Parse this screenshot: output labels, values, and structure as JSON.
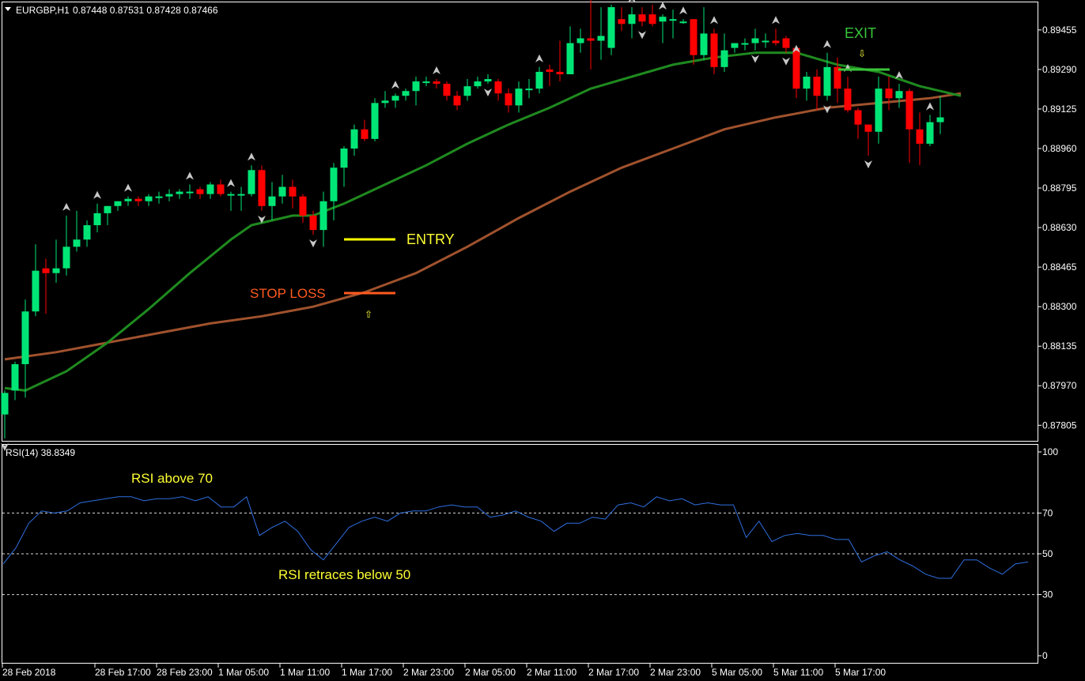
{
  "header": {
    "symbol": "EURGBP,H1",
    "ohlc": "0.87448 0.87531 0.87428 0.87466"
  },
  "rsi_panel": {
    "label": "RSI(14) 38.8349"
  },
  "colors": {
    "background": "#000000",
    "frame": "#ffffff",
    "bull_candle": "#00e676",
    "bear_candle": "#ff0000",
    "ma_fast": "#1f8a1f",
    "ma_slow": "#a0522d",
    "rsi_line": "#2f6fe0",
    "rsi_levels": "#d9d9d9",
    "signal_arrows": "#c8c8c8",
    "entry_color": "#ffff00",
    "stop_color": "#ff5a1f",
    "exit_color": "#39c639",
    "text_yellow": "#ffff33"
  },
  "annotations": {
    "entry": "ENTRY",
    "stop_loss": "STOP LOSS",
    "exit": "EXIT",
    "rsi_above": "RSI above 70",
    "rsi_retrace": "RSI retraces below 50"
  },
  "chart_data": [
    {
      "type": "candlestick",
      "title": "EURGBP,H1",
      "ylim": [
        0.8774,
        0.8957
      ],
      "y_ticks": [
        "0.89455",
        "0.89290",
        "0.89125",
        "0.88960",
        "0.88795",
        "0.88630",
        "0.88465",
        "0.88300",
        "0.88135",
        "0.87970",
        "0.87805"
      ],
      "x_ticks": [
        "28 Feb 2018",
        "28 Feb 17:00",
        "28 Feb 23:00",
        "1 Mar 05:00",
        "1 Mar 11:00",
        "1 Mar 17:00",
        "2 Mar 23:00",
        "2 Mar 05:00",
        "2 Mar 11:00",
        "2 Mar 17:00",
        "2 Mar 23:00",
        "5 Mar 05:00",
        "5 Mar 11:00",
        "5 Mar 17:00"
      ],
      "x_tick_candle": [
        0,
        9,
        15,
        21,
        27,
        33,
        39,
        45,
        51,
        57,
        63,
        69,
        75,
        81
      ],
      "series": [
        {
          "kind": "ohlc",
          "candles": [
            {
              "o": 0.8785,
              "h": 0.8795,
              "l": 0.8775,
              "c": 0.8794
            },
            {
              "o": 0.8795,
              "h": 0.8807,
              "l": 0.8791,
              "c": 0.8806
            },
            {
              "o": 0.8806,
              "h": 0.8833,
              "l": 0.8792,
              "c": 0.8828
            },
            {
              "o": 0.8828,
              "h": 0.8856,
              "l": 0.8826,
              "c": 0.8845
            },
            {
              "o": 0.8846,
              "h": 0.885,
              "l": 0.8827,
              "c": 0.8844
            },
            {
              "o": 0.8844,
              "h": 0.8858,
              "l": 0.884,
              "c": 0.8846
            },
            {
              "o": 0.8846,
              "h": 0.8868,
              "l": 0.8843,
              "c": 0.8855
            },
            {
              "o": 0.8855,
              "h": 0.887,
              "l": 0.8853,
              "c": 0.8858
            },
            {
              "o": 0.8858,
              "h": 0.8866,
              "l": 0.8855,
              "c": 0.8864
            },
            {
              "o": 0.8864,
              "h": 0.8873,
              "l": 0.8861,
              "c": 0.8869
            },
            {
              "o": 0.8869,
              "h": 0.8872,
              "l": 0.8864,
              "c": 0.8872
            },
            {
              "o": 0.8872,
              "h": 0.8873,
              "l": 0.887,
              "c": 0.8874
            },
            {
              "o": 0.8874,
              "h": 0.8876,
              "l": 0.8872,
              "c": 0.8875
            },
            {
              "o": 0.8875,
              "h": 0.8876,
              "l": 0.8872,
              "c": 0.8874
            },
            {
              "o": 0.8874,
              "h": 0.8877,
              "l": 0.8872,
              "c": 0.8876
            },
            {
              "o": 0.8876,
              "h": 0.8878,
              "l": 0.8873,
              "c": 0.8876
            },
            {
              "o": 0.8876,
              "h": 0.8879,
              "l": 0.8874,
              "c": 0.8877
            },
            {
              "o": 0.8877,
              "h": 0.8879,
              "l": 0.8875,
              "c": 0.8878
            },
            {
              "o": 0.8878,
              "h": 0.8881,
              "l": 0.8875,
              "c": 0.8878
            },
            {
              "o": 0.8879,
              "h": 0.888,
              "l": 0.8875,
              "c": 0.8877
            },
            {
              "o": 0.8877,
              "h": 0.8882,
              "l": 0.8875,
              "c": 0.8881
            },
            {
              "o": 0.8881,
              "h": 0.8883,
              "l": 0.8876,
              "c": 0.8877
            },
            {
              "o": 0.8877,
              "h": 0.8878,
              "l": 0.887,
              "c": 0.8877
            },
            {
              "o": 0.8877,
              "h": 0.888,
              "l": 0.887,
              "c": 0.8877
            },
            {
              "o": 0.8877,
              "h": 0.8889,
              "l": 0.8876,
              "c": 0.8887
            },
            {
              "o": 0.8887,
              "h": 0.8889,
              "l": 0.887,
              "c": 0.8872
            },
            {
              "o": 0.8872,
              "h": 0.8882,
              "l": 0.8866,
              "c": 0.8876
            },
            {
              "o": 0.8876,
              "h": 0.8885,
              "l": 0.8873,
              "c": 0.888
            },
            {
              "o": 0.888,
              "h": 0.8883,
              "l": 0.8871,
              "c": 0.8876
            },
            {
              "o": 0.8876,
              "h": 0.8877,
              "l": 0.8865,
              "c": 0.8868
            },
            {
              "o": 0.8868,
              "h": 0.887,
              "l": 0.886,
              "c": 0.8862
            },
            {
              "o": 0.8862,
              "h": 0.8878,
              "l": 0.8855,
              "c": 0.8874
            },
            {
              "o": 0.8874,
              "h": 0.889,
              "l": 0.8866,
              "c": 0.8888
            },
            {
              "o": 0.8888,
              "h": 0.8897,
              "l": 0.888,
              "c": 0.8896
            },
            {
              "o": 0.8896,
              "h": 0.8906,
              "l": 0.8893,
              "c": 0.8904
            },
            {
              "o": 0.8904,
              "h": 0.8908,
              "l": 0.8899,
              "c": 0.89
            },
            {
              "o": 0.89,
              "h": 0.8917,
              "l": 0.8899,
              "c": 0.8915
            },
            {
              "o": 0.8915,
              "h": 0.892,
              "l": 0.8913,
              "c": 0.8916
            },
            {
              "o": 0.8916,
              "h": 0.8919,
              "l": 0.8913,
              "c": 0.8918
            },
            {
              "o": 0.8918,
              "h": 0.8921,
              "l": 0.8916,
              "c": 0.892
            },
            {
              "o": 0.892,
              "h": 0.8926,
              "l": 0.8914,
              "c": 0.8924
            },
            {
              "o": 0.8924,
              "h": 0.8926,
              "l": 0.8922,
              "c": 0.8924
            },
            {
              "o": 0.8924,
              "h": 0.8925,
              "l": 0.8921,
              "c": 0.8923
            },
            {
              "o": 0.8923,
              "h": 0.8924,
              "l": 0.8916,
              "c": 0.8918
            },
            {
              "o": 0.8918,
              "h": 0.892,
              "l": 0.8912,
              "c": 0.8914
            },
            {
              "o": 0.8918,
              "h": 0.8925,
              "l": 0.8916,
              "c": 0.8922
            },
            {
              "o": 0.8922,
              "h": 0.8926,
              "l": 0.8921,
              "c": 0.8924
            },
            {
              "o": 0.8924,
              "h": 0.8927,
              "l": 0.8923,
              "c": 0.8925
            },
            {
              "o": 0.8924,
              "h": 0.8925,
              "l": 0.8916,
              "c": 0.8919
            },
            {
              "o": 0.8919,
              "h": 0.8921,
              "l": 0.8911,
              "c": 0.8914
            },
            {
              "o": 0.8914,
              "h": 0.8924,
              "l": 0.8911,
              "c": 0.8921
            },
            {
              "o": 0.8921,
              "h": 0.8925,
              "l": 0.8917,
              "c": 0.8921
            },
            {
              "o": 0.8921,
              "h": 0.893,
              "l": 0.8919,
              "c": 0.8928
            },
            {
              "o": 0.8929,
              "h": 0.8931,
              "l": 0.8922,
              "c": 0.8928
            },
            {
              "o": 0.8928,
              "h": 0.8941,
              "l": 0.8924,
              "c": 0.8927
            },
            {
              "o": 0.8927,
              "h": 0.8947,
              "l": 0.8927,
              "c": 0.894
            },
            {
              "o": 0.894,
              "h": 0.8946,
              "l": 0.8936,
              "c": 0.8942
            },
            {
              "o": 0.8942,
              "h": 0.896,
              "l": 0.8929,
              "c": 0.8941
            },
            {
              "o": 0.8941,
              "h": 0.8955,
              "l": 0.8933,
              "c": 0.8943
            },
            {
              "o": 0.8938,
              "h": 0.8956,
              "l": 0.8935,
              "c": 0.8955
            },
            {
              "o": 0.895,
              "h": 0.8955,
              "l": 0.8945,
              "c": 0.8948
            },
            {
              "o": 0.8948,
              "h": 0.8955,
              "l": 0.8942,
              "c": 0.8952
            },
            {
              "o": 0.8952,
              "h": 0.8955,
              "l": 0.8947,
              "c": 0.8949
            },
            {
              "o": 0.8952,
              "h": 0.8956,
              "l": 0.8947,
              "c": 0.8948
            },
            {
              "o": 0.8949,
              "h": 0.8952,
              "l": 0.894,
              "c": 0.8951
            },
            {
              "o": 0.895,
              "h": 0.8954,
              "l": 0.8942,
              "c": 0.895
            },
            {
              "o": 0.8949,
              "h": 0.895,
              "l": 0.8948,
              "c": 0.8949
            },
            {
              "o": 0.895,
              "h": 0.895,
              "l": 0.8931,
              "c": 0.8935
            },
            {
              "o": 0.8935,
              "h": 0.8955,
              "l": 0.8933,
              "c": 0.8944
            },
            {
              "o": 0.8944,
              "h": 0.8946,
              "l": 0.8927,
              "c": 0.893
            },
            {
              "o": 0.893,
              "h": 0.8944,
              "l": 0.8928,
              "c": 0.8937
            },
            {
              "o": 0.8938,
              "h": 0.894,
              "l": 0.8936,
              "c": 0.894
            },
            {
              "o": 0.894,
              "h": 0.8942,
              "l": 0.8937,
              "c": 0.894
            },
            {
              "o": 0.894,
              "h": 0.8946,
              "l": 0.8937,
              "c": 0.8942
            },
            {
              "o": 0.8941,
              "h": 0.8944,
              "l": 0.8938,
              "c": 0.8941
            },
            {
              "o": 0.8941,
              "h": 0.8946,
              "l": 0.8939,
              "c": 0.894
            },
            {
              "o": 0.8942,
              "h": 0.8943,
              "l": 0.8936,
              "c": 0.8938
            },
            {
              "o": 0.8938,
              "h": 0.8934,
              "l": 0.8917,
              "c": 0.8921
            },
            {
              "o": 0.8921,
              "h": 0.8928,
              "l": 0.8916,
              "c": 0.8926
            },
            {
              "o": 0.8926,
              "h": 0.8929,
              "l": 0.8912,
              "c": 0.8918
            },
            {
              "o": 0.8918,
              "h": 0.8936,
              "l": 0.8916,
              "c": 0.893
            },
            {
              "o": 0.893,
              "h": 0.8934,
              "l": 0.8915,
              "c": 0.8921
            },
            {
              "o": 0.8921,
              "h": 0.8926,
              "l": 0.8911,
              "c": 0.8912
            },
            {
              "o": 0.8912,
              "h": 0.8913,
              "l": 0.89,
              "c": 0.8906
            },
            {
              "o": 0.8906,
              "h": 0.8906,
              "l": 0.8893,
              "c": 0.8903
            },
            {
              "o": 0.8903,
              "h": 0.8926,
              "l": 0.8898,
              "c": 0.8921
            },
            {
              "o": 0.8921,
              "h": 0.8926,
              "l": 0.8912,
              "c": 0.8917
            },
            {
              "o": 0.8917,
              "h": 0.8923,
              "l": 0.8913,
              "c": 0.892
            },
            {
              "o": 0.892,
              "h": 0.8921,
              "l": 0.889,
              "c": 0.8904
            },
            {
              "o": 0.8904,
              "h": 0.8911,
              "l": 0.8889,
              "c": 0.8898
            },
            {
              "o": 0.8898,
              "h": 0.891,
              "l": 0.8897,
              "c": 0.8907
            },
            {
              "o": 0.8907,
              "h": 0.8918,
              "l": 0.8902,
              "c": 0.8909
            }
          ]
        },
        {
          "name": "",
          "kind": "ma_fast",
          "x": [
            0,
            2,
            6,
            10,
            14,
            18,
            22,
            24,
            26,
            28,
            30,
            33,
            37,
            41,
            45,
            49,
            53,
            57,
            61,
            65,
            69,
            73,
            77,
            81,
            85,
            89,
            93
          ],
          "values": [
            0.8796,
            0.8795,
            0.8803,
            0.8815,
            0.8829,
            0.8844,
            0.8858,
            0.8864,
            0.8866,
            0.8868,
            0.8868,
            0.8873,
            0.8881,
            0.8889,
            0.8898,
            0.8906,
            0.8913,
            0.8921,
            0.8926,
            0.8931,
            0.8934,
            0.8936,
            0.8936,
            0.8931,
            0.8928,
            0.8922,
            0.8918
          ]
        },
        {
          "name": "",
          "kind": "ma_slow",
          "x": [
            0,
            5,
            10,
            15,
            20,
            25,
            30,
            35,
            40,
            45,
            50,
            55,
            60,
            65,
            70,
            75,
            80,
            85,
            90,
            93
          ],
          "values": [
            0.8808,
            0.8811,
            0.8815,
            0.8819,
            0.8823,
            0.8826,
            0.883,
            0.8836,
            0.8844,
            0.8855,
            0.8867,
            0.8878,
            0.8888,
            0.8896,
            0.8904,
            0.8909,
            0.8913,
            0.8915,
            0.8917,
            0.8919
          ]
        }
      ],
      "up_arrows": [
        6,
        9,
        12,
        18,
        22,
        24,
        38,
        42,
        52,
        57,
        59,
        61,
        64,
        66,
        69,
        75,
        77,
        80,
        82,
        87,
        90,
        94
      ],
      "down_arrows": [
        0,
        25,
        30,
        47,
        62,
        73,
        76,
        80,
        84,
        92
      ]
    },
    {
      "type": "line",
      "title": "RSI(14) 38.8349",
      "ylim": [
        0,
        100
      ],
      "y_ticks": [
        "100",
        "70",
        "50",
        "30",
        "0"
      ],
      "levels": [
        70,
        50,
        30
      ],
      "series": [
        {
          "name": "",
          "values": [
            45,
            53,
            65,
            71,
            70,
            71,
            75,
            76,
            77,
            78,
            78,
            76,
            77,
            77,
            78,
            76,
            78,
            73,
            73,
            78,
            59,
            63,
            66,
            61,
            52,
            47,
            55,
            63,
            66,
            68,
            66,
            70,
            71,
            71,
            73,
            74,
            73,
            73,
            68,
            69,
            71,
            68,
            66,
            61,
            65,
            65,
            68,
            67,
            74,
            75,
            73,
            78,
            76,
            77,
            74,
            75,
            74,
            74,
            58,
            66,
            56,
            59,
            60,
            59,
            59,
            57,
            57,
            46,
            49,
            51,
            47,
            44,
            40,
            38,
            38,
            47,
            47,
            43,
            40,
            45,
            46
          ]
        }
      ]
    }
  ]
}
